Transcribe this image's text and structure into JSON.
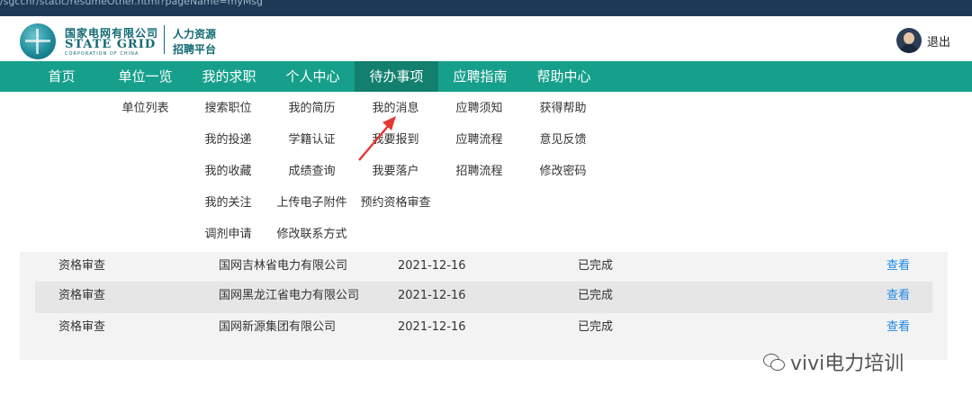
{
  "browser": {
    "url": "/sgcchr/static/resumeOther.html?pageName=myMsg"
  },
  "header": {
    "logo": {
      "cn": "国家电网有限公司",
      "en": "STATE GRID",
      "corp": "CORPORATION OF CHINA",
      "sub1": "人力资源",
      "sub2": "招聘平台"
    },
    "logout_label": "退出"
  },
  "nav": {
    "items": [
      {
        "label": "首页"
      },
      {
        "label": "单位一览"
      },
      {
        "label": "我的求职"
      },
      {
        "label": "个人中心"
      },
      {
        "label": "待办事项",
        "active": true
      },
      {
        "label": "应聘指南"
      },
      {
        "label": "帮助中心"
      }
    ]
  },
  "dropdown": {
    "col1": [
      "单位列表"
    ],
    "col2": [
      "搜索职位",
      "我的投递",
      "我的收藏",
      "我的关注",
      "调剂申请"
    ],
    "col3": [
      "我的简历",
      "学籍认证",
      "成绩查询",
      "上传电子附件",
      "修改联系方式"
    ],
    "col4": [
      "我的消息",
      "我要报到",
      "我要落户",
      "预约资格审查"
    ],
    "col5": [
      "应聘须知",
      "应聘流程",
      "招聘流程"
    ],
    "col6": [
      "获得帮助",
      "意见反馈",
      "修改密码"
    ]
  },
  "table": {
    "rows": [
      {
        "type": "资格审查",
        "company": "国网吉林省电力有限公司",
        "date": "2021-12-16",
        "status": "已完成",
        "action": "查看"
      },
      {
        "type": "资格审查",
        "company": "国网黑龙江省电力有限公司",
        "date": "2021-12-16",
        "status": "已完成",
        "action": "查看"
      },
      {
        "type": "资格审查",
        "company": "国网新源集团有限公司",
        "date": "2021-12-16",
        "status": "已完成",
        "action": "查看"
      }
    ]
  },
  "watermark": {
    "text": "vivi电力培训",
    "icon": "wechat-icon"
  },
  "colors": {
    "nav_bg": "#16a08b",
    "nav_active": "#13806f",
    "link": "#1e88e5",
    "arrow": "#e53935"
  }
}
